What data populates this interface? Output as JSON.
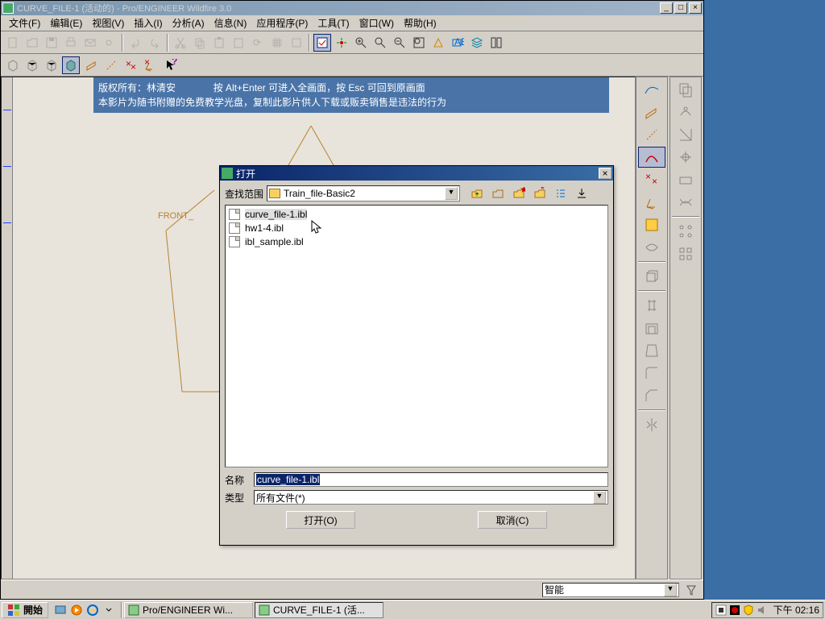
{
  "app": {
    "title": "CURVE_FILE-1 (活动的) - Pro/ENGINEER Wildfire 3.0"
  },
  "menu": {
    "file": "文件(F)",
    "edit": "编辑(E)",
    "view": "视图(V)",
    "insert": "插入(I)",
    "analysis": "分析(A)",
    "info": "信息(N)",
    "app": "应用程序(P)",
    "tools": "工具(T)",
    "window": "窗口(W)",
    "help": "帮助(H)"
  },
  "banner": {
    "line1a": "版权所有：林清安",
    "line1b": "按 Alt+Enter 可进入全画面，按 Esc 可回到原画面",
    "line2": "本影片为随书附赠的免费教学光盘，复制此影片供人下载或贩卖销售是违法的行为"
  },
  "canvas": {
    "front_label": "FRONT_"
  },
  "dialog": {
    "title": "打开",
    "look_in_label": "查找范围",
    "look_in_value": "Train_file-Basic2",
    "files": [
      {
        "name": "curve_file-1.ibl",
        "selected": true
      },
      {
        "name": "hw1-4.ibl",
        "selected": false
      },
      {
        "name": "ibl_sample.ibl",
        "selected": false
      }
    ],
    "name_label": "名称",
    "name_value": "curve_file-1.ibl",
    "type_label": "类型",
    "type_value": "所有文件(*)",
    "open_btn": "打开(O)",
    "cancel_btn": "取消(C)"
  },
  "statusbar": {
    "combo": "智能"
  },
  "taskbar": {
    "start": "開始",
    "task1": "Pro/ENGINEER Wi...",
    "task2": "CURVE_FILE-1 (活...",
    "clock": "下午 02:16"
  }
}
